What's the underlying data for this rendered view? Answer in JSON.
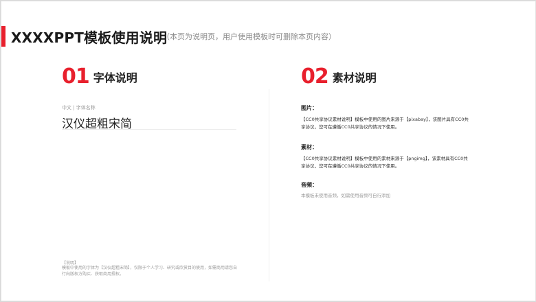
{
  "header": {
    "title": "XXXXPPT模板使用说明",
    "subtitle": "（本页为说明页，用户使用模板时可删除本页内容）",
    "accent_color": "#e8202d"
  },
  "font_section": {
    "number": "01",
    "title": "字体说明",
    "caption": "中文 | 字体名称",
    "font_name": "汉仪超粗宋简",
    "note_label": "【说明】",
    "note_text": "模板中使用的字体为【汉仪超粗宋简】，仅限于个人学习、研究或欣赏目的使用，如需商用请您自行向版权方购买、获取商用授权。"
  },
  "material_section": {
    "number": "02",
    "title": "素材说明",
    "items": [
      {
        "heading": "图片：",
        "text": "【CC0共享协议素材说明】模板中使用的图片来源于【pixabay】，该图片具有CC0共享协议，您可在遵循CC0共享协议的情况下使用。"
      },
      {
        "heading": "素材：",
        "text": "【CC0共享协议素材说明】模板中使用的素材来源于【pngimg】，该素材具有CC0共享协议，您可在遵循CC0共享协议的情况下使用。"
      },
      {
        "heading": "音频：",
        "text": "本模板未使用音频，如需使用音频可自行添加"
      }
    ]
  }
}
